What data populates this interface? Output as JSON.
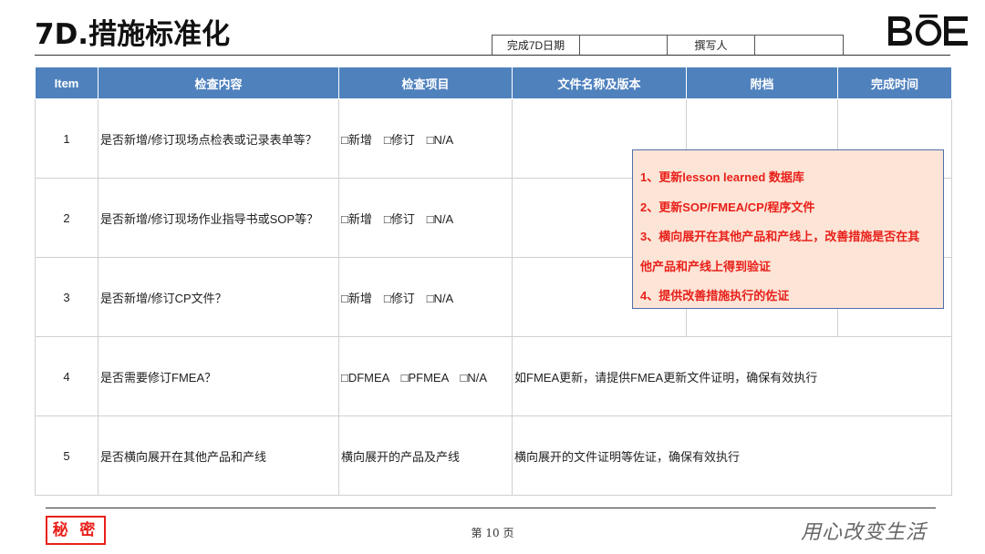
{
  "header": {
    "title": "7D.措施标准化",
    "meta_labels": [
      "完成7D日期",
      "",
      "撰写人",
      ""
    ],
    "logo_text": "BOE"
  },
  "table": {
    "headers": [
      "Item",
      "检查内容",
      "检查项目",
      "文件名称及版本",
      "附档",
      "完成时间"
    ],
    "rows": [
      {
        "item": "1",
        "content": "是否新增/修订现场点检表或记录表单等？",
        "check": "□新增　□修订　□N/A",
        "file": "",
        "attach": "",
        "time": ""
      },
      {
        "item": "2",
        "content": "是否新增/修订现场作业指导书或SOP等？",
        "check": "□新增　□修订　□N/A",
        "file": "",
        "attach": "",
        "time": ""
      },
      {
        "item": "3",
        "content": "是否新增/修订CP文件？",
        "check": "□新增　□修订　□N/A",
        "file": "",
        "attach": "",
        "time": ""
      },
      {
        "item": "4",
        "content": "是否需要修订FMEA？",
        "check": "□DFMEA　□PFMEA　□N/A",
        "file": "如FMEA更新，请提供FMEA更新文件证明，确保有效执行",
        "attach": "",
        "time": ""
      },
      {
        "item": "5",
        "content": "是否横向展开在其他产品和产线",
        "check": "横向展开的产品及产线",
        "file": "横向展开的文件证明等佐证，确保有效执行",
        "attach": "",
        "time": ""
      }
    ]
  },
  "note": {
    "lines": [
      "1、更新lesson learned 数据库",
      "2、更新SOP/FMEA/CP/程序文件",
      "3、横向展开在其他产品和产线上，改善措施是否在其",
      "他产品和产线上得到验证",
      "4、提供改善措施执行的佐证"
    ],
    "text_color": "#e8201a",
    "bg_color": "#fce4d6"
  },
  "footer": {
    "secret_label": "秘 密",
    "page_label": "第 10 页",
    "slogan": "用心改变生活"
  },
  "colors": {
    "header_blue": "#4f81bd",
    "secret_red": "#e8201a"
  }
}
